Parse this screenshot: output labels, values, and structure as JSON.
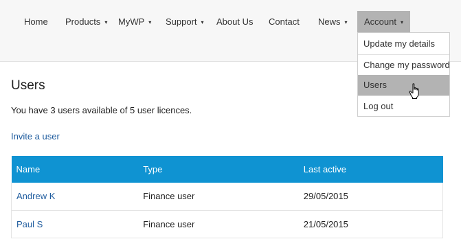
{
  "nav": {
    "items": [
      {
        "label": "Home",
        "has_caret": false
      },
      {
        "label": "Products",
        "has_caret": true
      },
      {
        "label": "MyWP",
        "has_caret": true
      },
      {
        "label": "Support",
        "has_caret": true
      },
      {
        "label": "About Us",
        "has_caret": false
      },
      {
        "label": "Contact",
        "has_caret": false
      },
      {
        "label": "News",
        "has_caret": true
      },
      {
        "label": "Account",
        "has_caret": true,
        "active": true
      }
    ],
    "caret": "▾"
  },
  "account_menu": {
    "items": [
      {
        "label": "Update my details"
      },
      {
        "label": "Change my password"
      },
      {
        "label": "Users",
        "highlighted": true
      },
      {
        "label": "Log out"
      }
    ]
  },
  "main": {
    "title": "Users",
    "licence_text": "You have 3 users available of 5 user licences.",
    "invite_link": "Invite a user"
  },
  "table": {
    "headers": [
      "Name",
      "Type",
      "Last active"
    ],
    "rows": [
      {
        "name": "Andrew K",
        "type": "Finance user",
        "last_active": "29/05/2015"
      },
      {
        "name": "Paul S",
        "type": "Finance user",
        "last_active": "21/05/2015"
      }
    ]
  },
  "colors": {
    "header_bg": "#0f93d2",
    "link": "#1f5c9e",
    "active_menu_bg": "#b3b3b3"
  },
  "icons": {
    "cursor": "hand-pointer-icon"
  }
}
